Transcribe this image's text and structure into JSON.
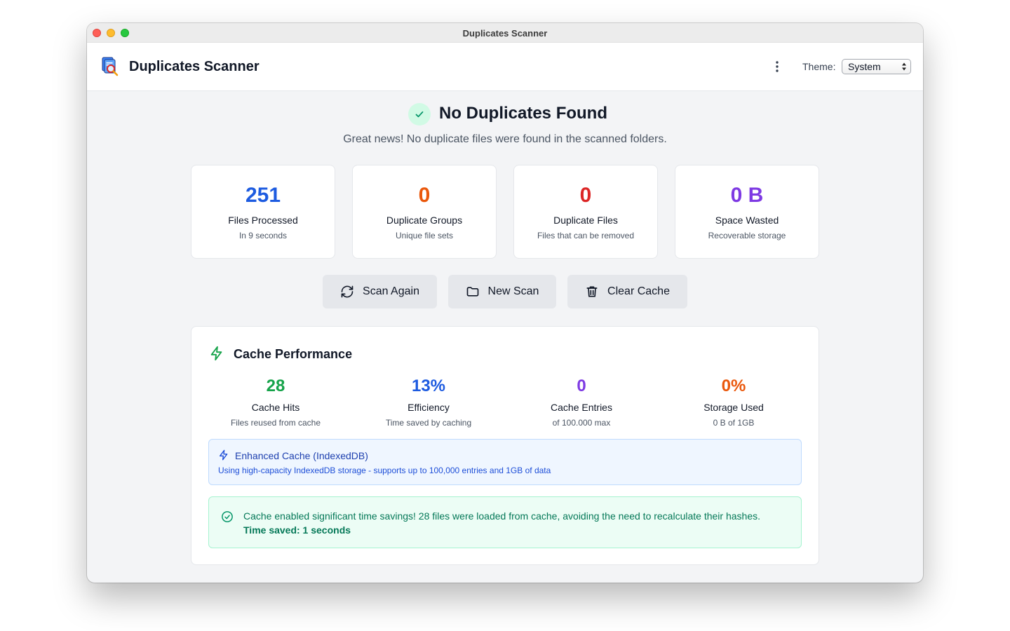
{
  "window": {
    "title": "Duplicates Scanner"
  },
  "header": {
    "app_title": "Duplicates Scanner",
    "theme_label": "Theme:",
    "theme_value": "System"
  },
  "hero": {
    "title": "No Duplicates Found",
    "subtitle": "Great news! No duplicate files were found in the scanned folders."
  },
  "stats": [
    {
      "value": "251",
      "label": "Files Processed",
      "sub": "In 9 seconds",
      "color": "#1d5be0"
    },
    {
      "value": "0",
      "label": "Duplicate Groups",
      "sub": "Unique file sets",
      "color": "#ea580c"
    },
    {
      "value": "0",
      "label": "Duplicate Files",
      "sub": "Files that can be removed",
      "color": "#dc2626"
    },
    {
      "value": "0 B",
      "label": "Space Wasted",
      "sub": "Recoverable storage",
      "color": "#7e3ae3"
    }
  ],
  "actions": {
    "scan_again": "Scan Again",
    "new_scan": "New Scan",
    "clear_cache": "Clear Cache"
  },
  "cache": {
    "title": "Cache Performance",
    "metrics": [
      {
        "value": "28",
        "label": "Cache Hits",
        "sub": "Files reused from cache",
        "color": "#16a34a"
      },
      {
        "value": "13%",
        "label": "Efficiency",
        "sub": "Time saved by caching",
        "color": "#1d5be0"
      },
      {
        "value": "0",
        "label": "Cache Entries",
        "sub": "of 100.000 max",
        "color": "#7e3ae3"
      },
      {
        "value": "0%",
        "label": "Storage Used",
        "sub": "0 B of 1GB",
        "color": "#ea580c"
      }
    ],
    "info_title": "Enhanced Cache (IndexedDB)",
    "info_desc": "Using high-capacity IndexedDB storage - supports up to 100,000 entries and 1GB of data",
    "success_msg": "Cache enabled significant time savings! 28 files were loaded from cache, avoiding the need to recalculate their hashes.",
    "success_time": "Time saved: 1 seconds"
  },
  "icons": {
    "app_logo": "app-logo-icon",
    "menu": "kebab-menu-icon",
    "hero": "checkmark-icon",
    "scan_again": "refresh-icon",
    "new_scan": "folder-icon",
    "clear_cache": "trash-icon",
    "cache": "lightning-icon",
    "success": "check-circle-icon"
  }
}
